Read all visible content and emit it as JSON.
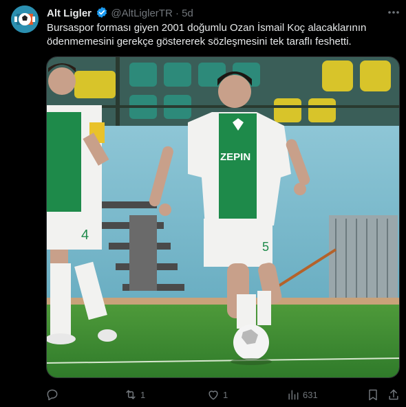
{
  "author": {
    "display_name": "Alt Ligler",
    "handle": "@AltLiglerTR",
    "separator": "·",
    "time": "5d",
    "verified": true
  },
  "tweet": {
    "text": "Bursaspor forması giyen 2001 doğumlu Ozan İsmail Koç alacaklarının ödenmemesini gerekçe göstererek sözleşmesini tek taraflı feshetti."
  },
  "media": {
    "jersey_numbers": [
      "4",
      "5"
    ],
    "sponsor_text": "ZEPIN"
  },
  "actions": {
    "reply_count": "",
    "retweet_count": "1",
    "like_count": "1",
    "views_count": "631"
  },
  "colors": {
    "background": "#000000",
    "text": "#e7e9ea",
    "muted": "#71767b",
    "verified": "#1d9bf0",
    "jersey_green": "#1e8a4a",
    "pitch_green": "#3f8f34"
  },
  "icons": [
    "more-icon",
    "verified-icon",
    "reply-icon",
    "retweet-icon",
    "like-icon",
    "views-icon",
    "bookmark-icon",
    "share-icon"
  ]
}
